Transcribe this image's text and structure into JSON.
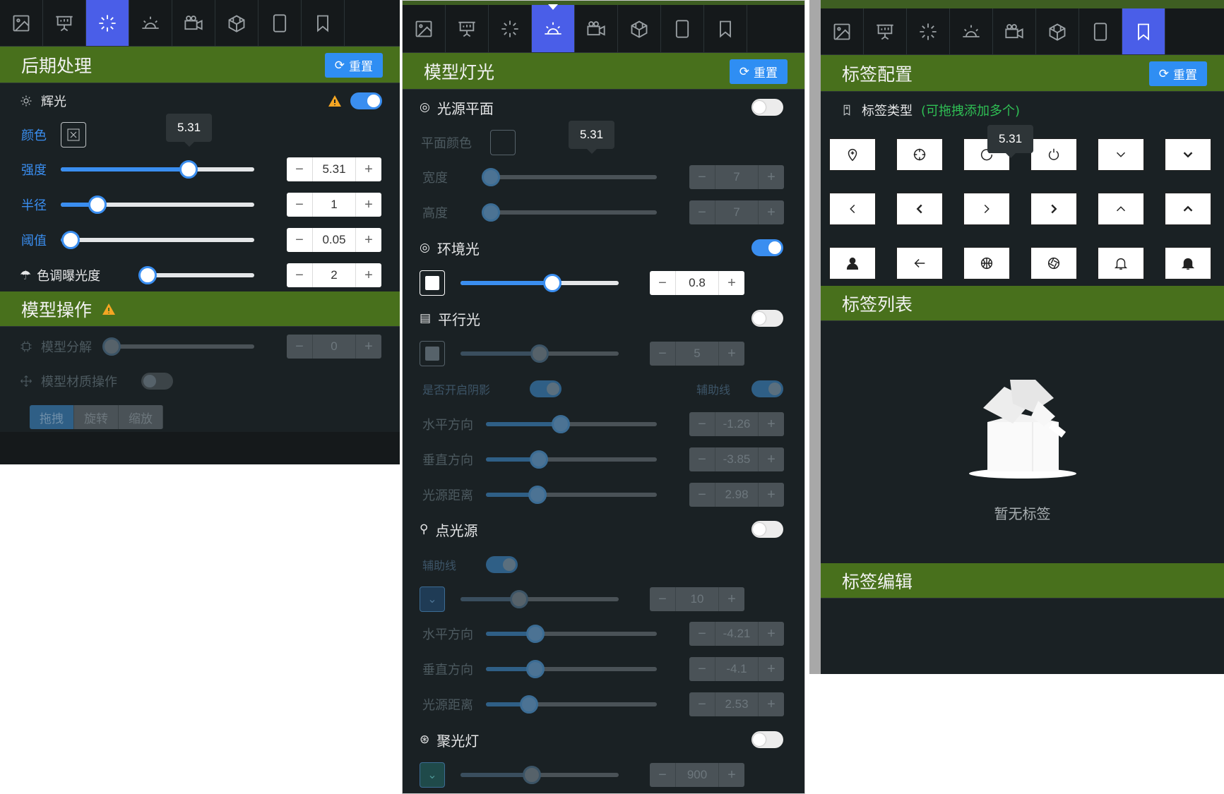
{
  "tabs": {
    "icons": [
      "image-icon",
      "presentation-icon",
      "sparkle-icon",
      "sunrise-icon",
      "camera-icon",
      "box-icon",
      "tablet-icon",
      "bookmark-icon"
    ]
  },
  "panel1": {
    "header_title": "后期处理",
    "reset_label": "重置",
    "glow_label": "辉光",
    "glow_enabled": true,
    "color_label": "颜色",
    "tooltip": "5.31",
    "sliders": [
      {
        "label": "强度",
        "value": "5.31",
        "fraction": 0.66
      },
      {
        "label": "半径",
        "value": "1",
        "fraction": 0.19
      },
      {
        "label": "阈值",
        "value": "0.05",
        "fraction": 0.05
      },
      {
        "label": "色调曝光度",
        "value": "2",
        "fraction": 0.08
      }
    ],
    "section2_title": "模型操作",
    "decompose_label": "模型分解",
    "decompose_value": "0",
    "material_label": "模型材质操作",
    "segments": [
      "拖拽",
      "旋转",
      "缩放"
    ],
    "selected_segment": "拖拽"
  },
  "panel2": {
    "header_title": "模型灯光",
    "reset_label": "重置",
    "tooltip": "5.31",
    "plane": {
      "title": "光源平面",
      "enabled": false,
      "color_label": "平面颜色",
      "width_label": "宽度",
      "width_value": "7",
      "height_label": "高度",
      "height_value": "7"
    },
    "ambient": {
      "title": "环境光",
      "enabled": true,
      "value": "0.8",
      "fraction": 0.58
    },
    "directional": {
      "title": "平行光",
      "enabled": false,
      "value": "5",
      "fraction": 0.5,
      "shadow_label": "是否开启阴影",
      "helper_label": "辅助线",
      "horizontal_label": "水平方向",
      "horizontal_value": "-1.26",
      "vertical_label": "垂直方向",
      "vertical_value": "-3.85",
      "distance_label": "光源距离",
      "distance_value": "2.98"
    },
    "point": {
      "title": "点光源",
      "enabled": false,
      "helper_label": "辅助线",
      "value": "10",
      "fraction": 0.37,
      "horizontal_label": "水平方向",
      "horizontal_value": "-4.21",
      "vertical_label": "垂直方向",
      "vertical_value": "-4.1",
      "distance_label": "光源距离",
      "distance_value": "2.53"
    },
    "spot": {
      "title": "聚光灯",
      "enabled": false,
      "value": "900",
      "fraction": 0.45
    }
  },
  "panel3": {
    "header_title": "标签配置",
    "reset_label": "重置",
    "type_label": "标签类型",
    "type_hint": "(可拖拽添加多个)",
    "tooltip": "5.31",
    "icon_buttons": [
      "location-pin-icon",
      "crosshair-icon",
      "refresh-icon",
      "power-icon",
      "chevron-down-icon",
      "chevron-down-bold-icon",
      "chevron-left-icon",
      "chevron-left-bold-icon",
      "chevron-right-icon",
      "chevron-right-bold-icon",
      "chevron-up-icon",
      "chevron-up-bold-icon",
      "user-icon",
      "arrow-left-icon",
      "basketball-icon",
      "aperture-icon",
      "bell-icon",
      "bell-filled-icon"
    ],
    "list_title": "标签列表",
    "empty_text": "暂无标签",
    "edit_title": "标签编辑"
  },
  "colors": {
    "header_green": "#48701c",
    "accent_blue": "#3a8ef0",
    "active_tab": "#4a5ee8",
    "panel_bg": "#1a2124"
  }
}
